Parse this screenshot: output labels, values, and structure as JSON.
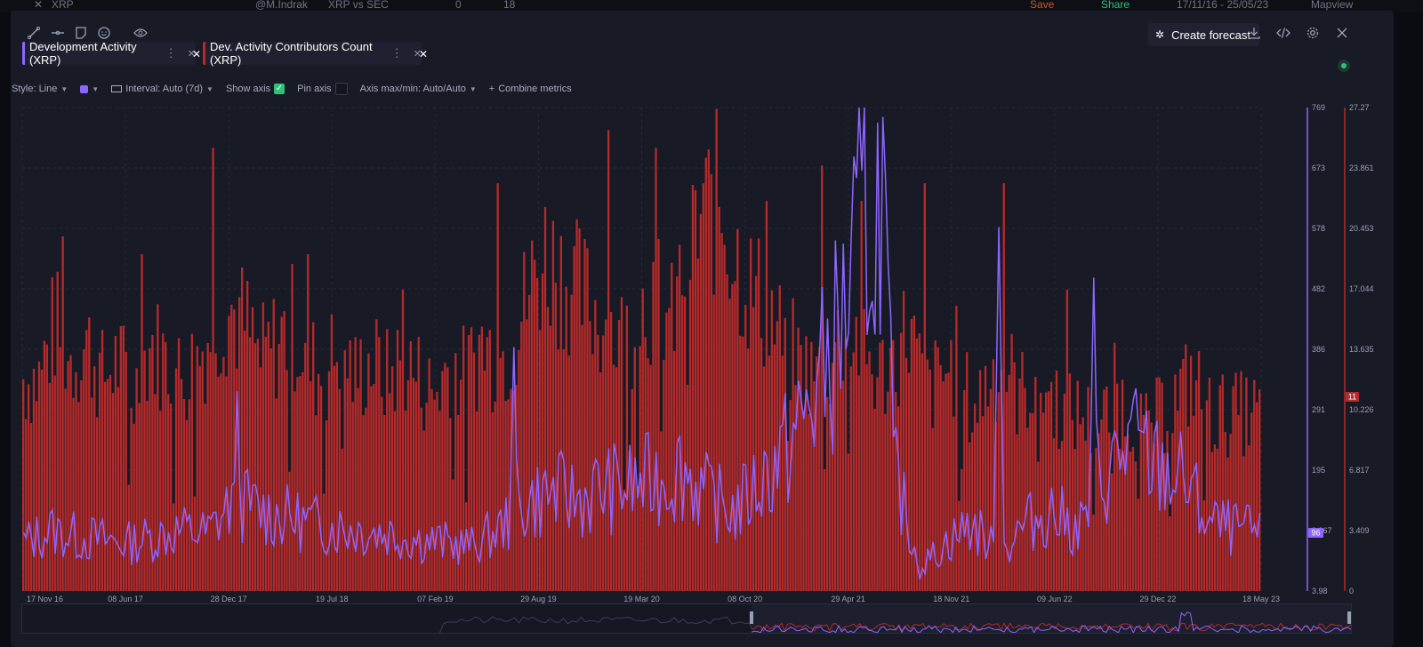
{
  "top_strip": {
    "symbol": "XRP",
    "user": "@M.Indrak",
    "title": "XRP vs SEC",
    "comments": "0",
    "likes": "18",
    "save": "Save",
    "share": "Share",
    "date_range": "17/11/16 - 25/05/23",
    "mapview": "Mapview"
  },
  "toolbar": {
    "create_forecast": "Create forecast"
  },
  "metrics": [
    {
      "label": "Development Activity (XRP)",
      "color": "#8e66ff"
    },
    {
      "label": "Dev. Activity Contributors Count (XRP)",
      "color": "#b52a2a"
    }
  ],
  "settings": {
    "style": "Style: Line",
    "interval": "Interval: Auto (7d)",
    "show_axis": "Show axis",
    "pin_axis": "Pin axis",
    "axis_maxmin": "Axis max/min: Auto/Auto",
    "combine": "Combine metrics"
  },
  "chart_data": {
    "type": "bar",
    "x_ticks": [
      "17 Nov 16",
      "08 Jun 17",
      "28 Dec 17",
      "19 Jul 18",
      "07 Feb 19",
      "29 Aug 19",
      "19 Mar 20",
      "08 Oct 20",
      "29 Apr 21",
      "18 Nov 21",
      "09 Jun 22",
      "29 Dec 22",
      "18 May 23"
    ],
    "y_left_ticks": [
      "769",
      "673",
      "578",
      "482",
      "386",
      "291",
      "195",
      "3.967",
      "3.98"
    ],
    "y_right_ticks": [
      "27.27",
      "23.861",
      "20.453",
      "17.044",
      "13.635",
      "10.226",
      "6.817",
      "3.409",
      "0"
    ],
    "y_left_range": [
      3.98,
      769
    ],
    "y_right_range": [
      0,
      27.27
    ],
    "last_value_left": "96",
    "last_value_right": "11",
    "series": [
      {
        "name": "Dev. Activity Contributors Count (XRP)",
        "type": "bar",
        "axis": "right",
        "color": "#b52a2a",
        "keyframes": [
          [
            0,
            12
          ],
          [
            6,
            12
          ],
          [
            12,
            15
          ],
          [
            18,
            13
          ],
          [
            24,
            14
          ],
          [
            30,
            12
          ],
          [
            36,
            13
          ],
          [
            42,
            11
          ],
          [
            48,
            14
          ],
          [
            54,
            13
          ],
          [
            60,
            12
          ],
          [
            66,
            13
          ],
          [
            72,
            15
          ],
          [
            78,
            16
          ],
          [
            84,
            15
          ],
          [
            90,
            13
          ],
          [
            96,
            14
          ],
          [
            102,
            15
          ],
          [
            108,
            13
          ],
          [
            114,
            12
          ],
          [
            120,
            14
          ],
          [
            126,
            12
          ],
          [
            132,
            13
          ],
          [
            138,
            12
          ],
          [
            144,
            13
          ],
          [
            150,
            12
          ],
          [
            156,
            11
          ],
          [
            162,
            13
          ],
          [
            168,
            12
          ],
          [
            174,
            14
          ],
          [
            180,
            13
          ],
          [
            186,
            14
          ],
          [
            192,
            17
          ],
          [
            198,
            19
          ],
          [
            204,
            18
          ],
          [
            210,
            17
          ],
          [
            216,
            16
          ],
          [
            222,
            15
          ],
          [
            228,
            14
          ],
          [
            234,
            16
          ],
          [
            240,
            17
          ],
          [
            246,
            15
          ],
          [
            252,
            19
          ],
          [
            258,
            21
          ],
          [
            264,
            22
          ],
          [
            270,
            19
          ],
          [
            276,
            17
          ],
          [
            282,
            16
          ],
          [
            288,
            14
          ],
          [
            294,
            13
          ],
          [
            300,
            12
          ],
          [
            306,
            13
          ],
          [
            312,
            15
          ],
          [
            318,
            14
          ],
          [
            324,
            12
          ],
          [
            330,
            13
          ],
          [
            336,
            15
          ],
          [
            342,
            11
          ],
          [
            348,
            12
          ],
          [
            354,
            13
          ],
          [
            360,
            10
          ],
          [
            366,
            12
          ],
          [
            372,
            13
          ],
          [
            378,
            11
          ],
          [
            384,
            12
          ],
          [
            390,
            11
          ],
          [
            396,
            10
          ],
          [
            402,
            10
          ],
          [
            408,
            9
          ],
          [
            414,
            11
          ],
          [
            420,
            10
          ],
          [
            426,
            9
          ],
          [
            432,
            10
          ],
          [
            438,
            11
          ],
          [
            444,
            12
          ],
          [
            450,
            10
          ]
        ],
        "spikes": [
          [
            15,
            20
          ],
          [
            45,
            19
          ],
          [
            72,
            25
          ],
          [
            108,
            19
          ],
          [
            144,
            17
          ],
          [
            180,
            23
          ],
          [
            222,
            26
          ],
          [
            240,
            25
          ],
          [
            258,
            23
          ],
          [
            282,
            22
          ],
          [
            303,
            24
          ],
          [
            318,
            22
          ],
          [
            342,
            23
          ],
          [
            372,
            23
          ],
          [
            396,
            17
          ],
          [
            414,
            14
          ]
        ]
      },
      {
        "name": "Development Activity (XRP)",
        "type": "line",
        "axis": "left",
        "color": "#8e66ff",
        "keyframes": [
          [
            0,
            80
          ],
          [
            10,
            100
          ],
          [
            20,
            90
          ],
          [
            30,
            85
          ],
          [
            40,
            80
          ],
          [
            50,
            90
          ],
          [
            60,
            100
          ],
          [
            70,
            95
          ],
          [
            80,
            150
          ],
          [
            90,
            130
          ],
          [
            100,
            120
          ],
          [
            110,
            110
          ],
          [
            120,
            105
          ],
          [
            130,
            100
          ],
          [
            140,
            95
          ],
          [
            150,
            85
          ],
          [
            160,
            80
          ],
          [
            170,
            75
          ],
          [
            180,
            100
          ],
          [
            190,
            140
          ],
          [
            200,
            160
          ],
          [
            210,
            150
          ],
          [
            220,
            165
          ],
          [
            230,
            170
          ],
          [
            240,
            180
          ],
          [
            250,
            200
          ],
          [
            260,
            150
          ],
          [
            270,
            130
          ],
          [
            280,
            180
          ],
          [
            290,
            230
          ],
          [
            300,
            310
          ],
          [
            310,
            420
          ],
          [
            320,
            600
          ],
          [
            325,
            730
          ],
          [
            330,
            200
          ],
          [
            340,
            40
          ],
          [
            350,
            80
          ],
          [
            360,
            110
          ],
          [
            370,
            60
          ],
          [
            380,
            110
          ],
          [
            390,
            130
          ],
          [
            400,
            100
          ],
          [
            410,
            180
          ],
          [
            420,
            240
          ],
          [
            430,
            200
          ],
          [
            440,
            180
          ],
          [
            450,
            110
          ],
          [
            460,
            100
          ],
          [
            470,
            96
          ]
        ],
        "spikes": [
          [
            81,
            320
          ],
          [
            186,
            390
          ],
          [
            324,
            745
          ],
          [
            370,
            580
          ],
          [
            406,
            500
          ]
        ]
      }
    ]
  }
}
